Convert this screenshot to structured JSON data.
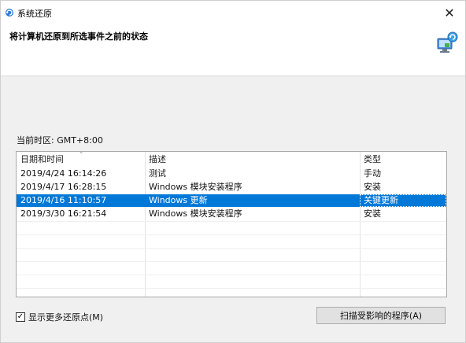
{
  "window": {
    "title": "系统还原",
    "close_glyph": "✕",
    "app_icon": "system-restore-icon"
  },
  "header": {
    "title": "将计算机还原到所选事件之前的状态",
    "icon": "computer-restore-icon"
  },
  "timezone": "当前时区: GMT+8:00",
  "table": {
    "columns": [
      "日期和时间",
      "描述",
      "类型"
    ],
    "sort_indicator": "˄",
    "rows": [
      {
        "datetime": "2019/4/24 16:14:26",
        "description": "测试",
        "type": "手动",
        "selected": false
      },
      {
        "datetime": "2019/4/17 16:28:15",
        "description": "Windows 模块安装程序",
        "type": "安装",
        "selected": false
      },
      {
        "datetime": "2019/4/16 11:10:57",
        "description": "Windows 更新",
        "type": "关键更新",
        "selected": true
      },
      {
        "datetime": "2019/3/30 16:21:54",
        "description": "Windows 模块安装程序",
        "type": "安装",
        "selected": false
      }
    ],
    "selection_color": "#0078d7"
  },
  "footer": {
    "show_more_label": "显示更多还原点(M)",
    "show_more_checked": true,
    "check_glyph": "✓",
    "scan_button_label": "扫描受影响的程序(A)"
  }
}
